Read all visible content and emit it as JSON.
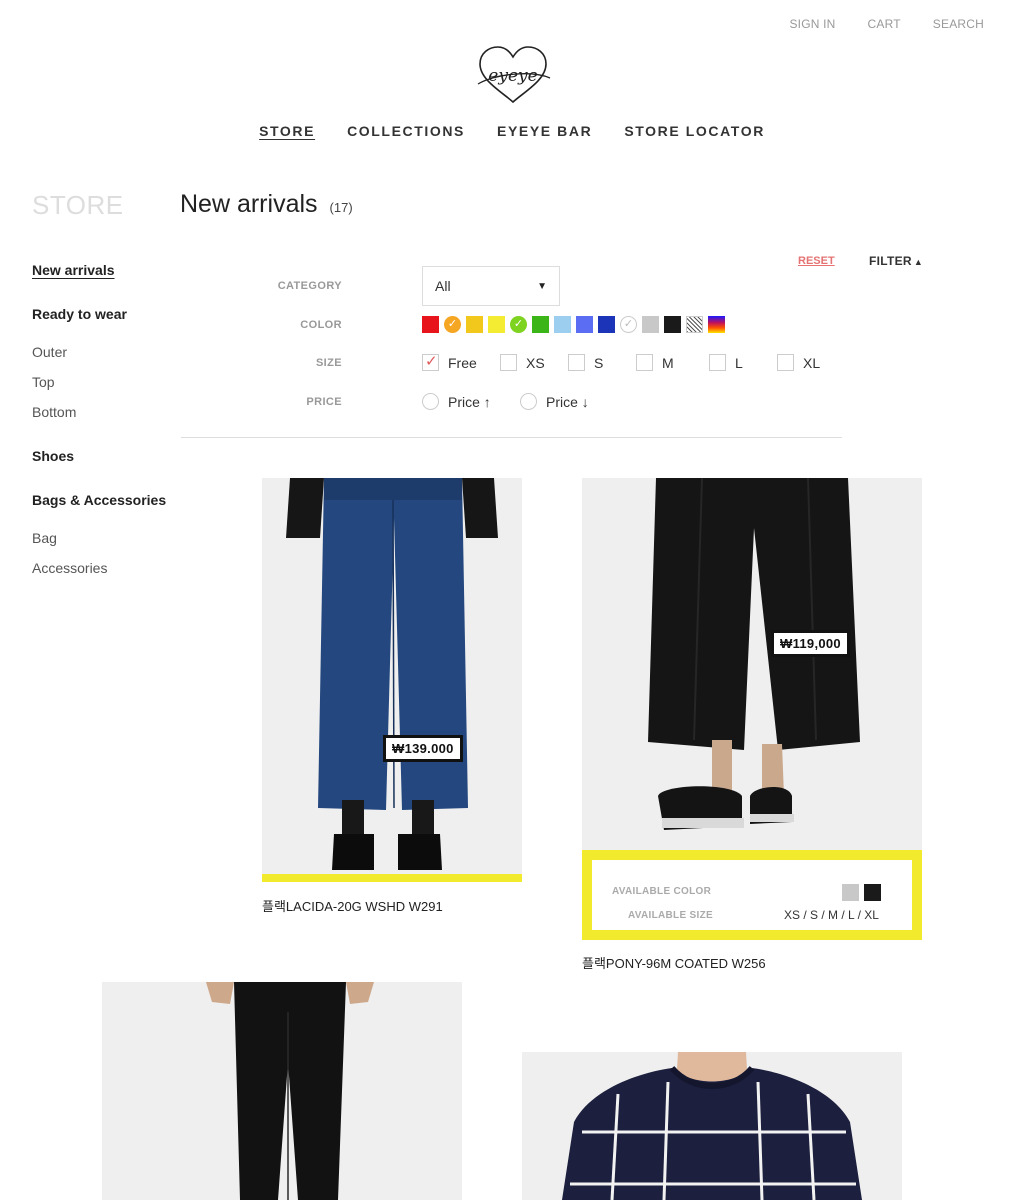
{
  "utility_nav": [
    {
      "label": "SIGN IN"
    },
    {
      "label": "CART"
    },
    {
      "label": "SEARCH"
    }
  ],
  "brand": {
    "logo_text": "eyeye"
  },
  "main_nav": [
    {
      "label": "STORE",
      "active": true
    },
    {
      "label": "COLLECTIONS"
    },
    {
      "label": "EYEYE BAR"
    },
    {
      "label": "STORE LOCATOR"
    }
  ],
  "sidebar": {
    "title": "STORE",
    "items": [
      {
        "label": "New arrivals",
        "style": "active"
      },
      {
        "label": "Ready to wear",
        "style": "bold"
      },
      {
        "label": "Outer",
        "style": "sub"
      },
      {
        "label": "Top",
        "style": "sub"
      },
      {
        "label": "Bottom",
        "style": "sub"
      },
      {
        "label": "Shoes",
        "style": "bold"
      },
      {
        "label": "Bags & Accessories",
        "style": "bold"
      },
      {
        "label": "Bag",
        "style": "sub"
      },
      {
        "label": "Accessories",
        "style": "sub"
      }
    ]
  },
  "page": {
    "title": "New arrivals",
    "count": "(17)"
  },
  "filter": {
    "reset_label": "RESET",
    "toggle_label": "FILTER",
    "toggle_icon": "triangle-up-icon",
    "category_label": "CATEGORY",
    "category_value": "All",
    "color_label": "COLOR",
    "size_label": "SIZE",
    "price_label": "PRICE",
    "colors": [
      {
        "hex": "#e8141c",
        "shape": "square",
        "selected": false
      },
      {
        "hex": "#f5a623",
        "shape": "round",
        "selected": true
      },
      {
        "hex": "#f2c81c",
        "shape": "square",
        "selected": false
      },
      {
        "hex": "#f4ec32",
        "shape": "square",
        "selected": false
      },
      {
        "hex": "#7ed321",
        "shape": "round",
        "selected": true
      },
      {
        "hex": "#3cb518",
        "shape": "square",
        "selected": false
      },
      {
        "hex": "#9ccfef",
        "shape": "square",
        "selected": false
      },
      {
        "hex": "#5b6df2",
        "shape": "square",
        "selected": false
      },
      {
        "hex": "#1b34b8",
        "shape": "square",
        "selected": false
      },
      {
        "hex": "#ffffff",
        "shape": "round",
        "selected": true
      },
      {
        "hex": "#c8c8c8",
        "shape": "square",
        "selected": false
      },
      {
        "hex": "#1a1a1a",
        "shape": "square",
        "selected": false
      },
      {
        "hex": "pattern",
        "shape": "square",
        "selected": false
      },
      {
        "hex": "gradient",
        "shape": "square",
        "selected": false
      }
    ],
    "sizes": [
      {
        "label": "Free",
        "checked": true
      },
      {
        "label": "XS",
        "checked": false
      },
      {
        "label": "S",
        "checked": false
      },
      {
        "label": "M",
        "checked": false
      },
      {
        "label": "L",
        "checked": false
      },
      {
        "label": "XL",
        "checked": false
      }
    ],
    "prices": [
      {
        "label": "Price ↑"
      },
      {
        "label": "Price ↓"
      }
    ]
  },
  "products": [
    {
      "name": "플랙LACIDA-20G WSHD W291",
      "price": "₩139.000",
      "photo": "denim-wide-jeans-photo"
    },
    {
      "name": "플랙PONY-96M COATED W256",
      "price": "₩119,000",
      "photo": "black-wide-trousers-photo",
      "available_color_label": "AVAILABLE COLOR",
      "available_size_label": "AVAILABLE SIZE",
      "available_colors": [
        "#c8c8c8",
        "#1a1a1a"
      ],
      "available_sizes": "XS / S / M / L / XL"
    },
    {
      "photo": "black-skinny-pants-photo"
    },
    {
      "photo": "navy-grid-sweater-photo"
    }
  ],
  "accent_colors": {
    "highlight": "#f2ea2c",
    "reset": "#e57373",
    "check": "#e05a5a"
  }
}
